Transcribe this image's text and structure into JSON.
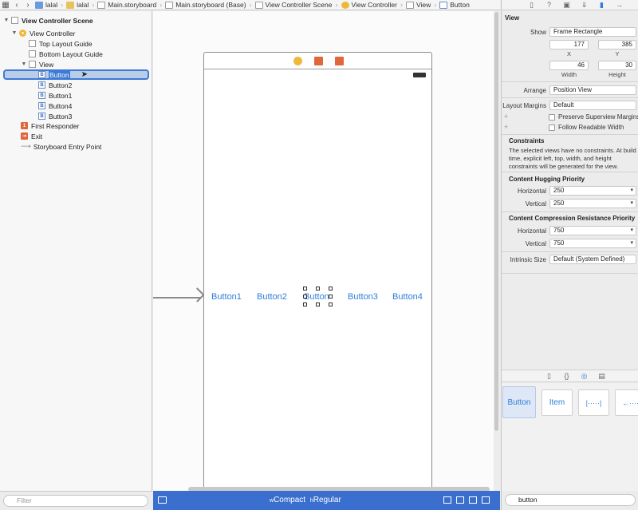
{
  "jumpbar": {
    "crumbs": [
      "lalal",
      "lalal",
      "Main.storyboard",
      "Main.storyboard (Base)",
      "View Controller Scene",
      "View Controller",
      "View",
      "Button"
    ]
  },
  "outline": {
    "scene": "View Controller Scene",
    "view_controller": "View Controller",
    "top_layout_guide": "Top Layout Guide",
    "bottom_layout_guide": "Bottom Layout Guide",
    "view": "View",
    "buttons": [
      "Button",
      "Button2",
      "Button1",
      "Button4",
      "Button3"
    ],
    "first_responder": "First Responder",
    "exit": "Exit",
    "entry_point": "Storyboard Entry Point"
  },
  "filter": {
    "placeholder": "Filter"
  },
  "canvas": {
    "buttons": [
      "Button1",
      "Button2",
      "Button",
      "Button3",
      "Button4"
    ]
  },
  "size_class": {
    "w_prefix": "w",
    "w_value": "Compact",
    "h_prefix": "h",
    "h_value": "Regular"
  },
  "inspector": {
    "section_title": "View",
    "show_label": "Show",
    "show_value": "Frame Rectangle",
    "x": "177",
    "y": "385",
    "x_label": "X",
    "y_label": "Y",
    "width": "46",
    "height": "30",
    "width_label": "Width",
    "height_label": "Height",
    "arrange_label": "Arrange",
    "arrange_value": "Position View",
    "layout_margins_label": "Layout Margins",
    "layout_margins_value": "Default",
    "preserve_superview": "Preserve Superview Margins",
    "follow_readable": "Follow Readable Width",
    "constraints_title": "Constraints",
    "constraints_note": "The selected views have no constraints. At build time, explicit left, top, width, and height constraints will be generated for the view.",
    "hugging_title": "Content Hugging Priority",
    "horizontal_label": "Horizontal",
    "vertical_label": "Vertical",
    "hugging_h": "250",
    "hugging_v": "250",
    "compression_title": "Content Compression Resistance Priority",
    "compression_h": "750",
    "compression_v": "750",
    "intrinsic_label": "Intrinsic Size",
    "intrinsic_value": "Default (System Defined)"
  },
  "library": {
    "items": [
      "Button",
      "Item"
    ],
    "search_value": "button"
  },
  "colors": {
    "accent": "#2f7ed8",
    "selection": "#3d7bd6",
    "bottom_bar": "#3a6fcf"
  }
}
